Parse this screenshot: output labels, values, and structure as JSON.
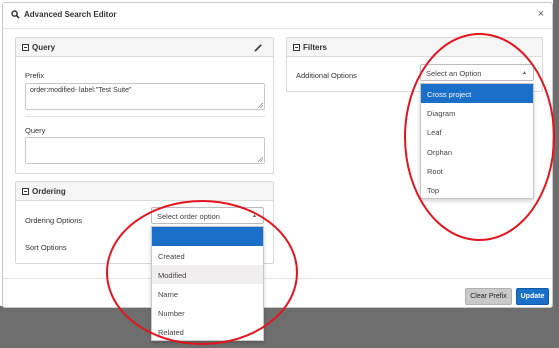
{
  "modal": {
    "title": "Advanced Search Editor",
    "close_label": "×"
  },
  "query_panel": {
    "heading": "Query",
    "prefix_label": "Prefix",
    "prefix_value": "order:modified-  label:\"Test Suite\"",
    "query_label": "Query",
    "query_value": ""
  },
  "ordering_panel": {
    "heading": "Ordering",
    "ordering_options_label": "Ordering Options",
    "sort_options_label": "Sort Options",
    "order_select_placeholder": "Select order option",
    "order_options": [
      "",
      "Created",
      "Modified",
      "Name",
      "Number",
      "Related"
    ],
    "highlighted_option_index": 0,
    "hovered_option_index": 2
  },
  "filters_panel": {
    "heading": "Filters",
    "additional_options_label": "Additional Options",
    "option_select_placeholder": "Select an Option",
    "filter_options": [
      "Cross project",
      "Diagram",
      "Leaf",
      "Orphan",
      "Root",
      "Top"
    ],
    "highlighted_option_index": 0
  },
  "footer": {
    "clear_prefix_label": "Clear Prefix",
    "update_label": "Update"
  },
  "colors": {
    "accent": "#1a6fc9",
    "annotation": "#e4141e",
    "backdrop": "#6e6e6e"
  }
}
